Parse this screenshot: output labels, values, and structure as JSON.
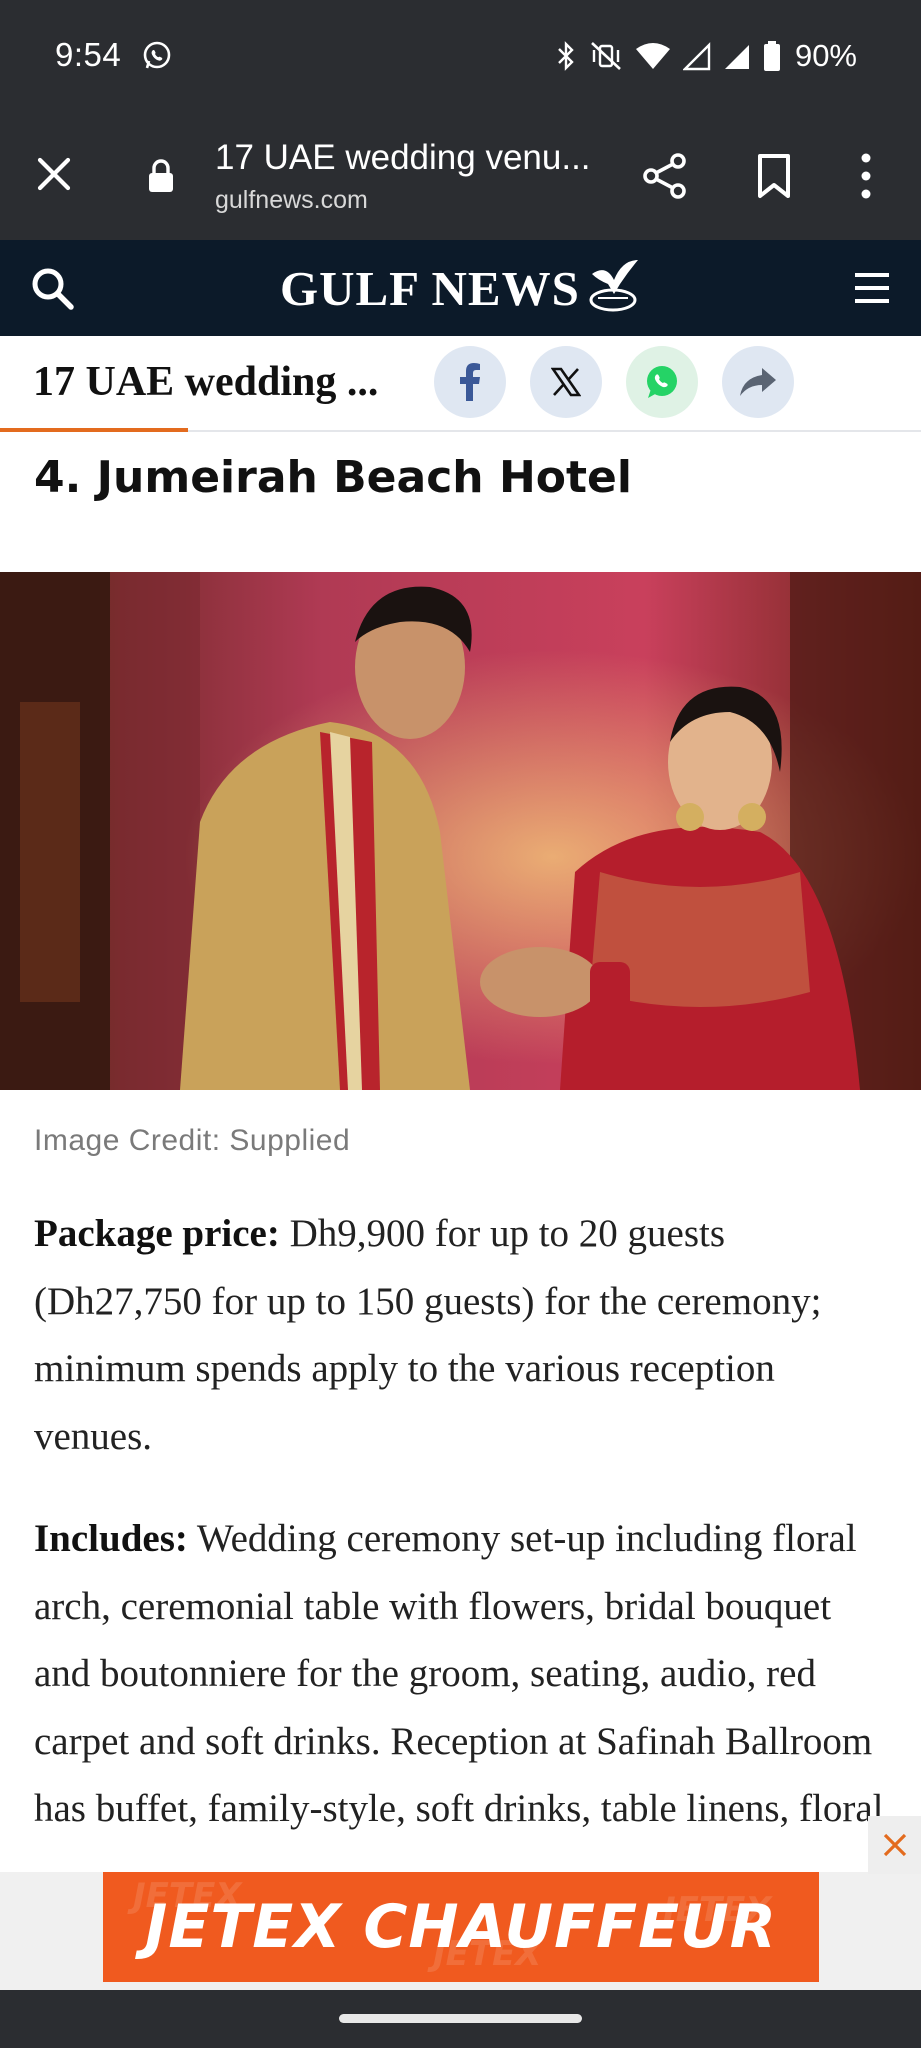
{
  "status_bar": {
    "time": "9:54",
    "battery": "90%"
  },
  "browser": {
    "page_title": "17 UAE wedding venu...",
    "url": "gulfnews.com"
  },
  "site": {
    "logo": "GULF NEWS"
  },
  "sticky_bar": {
    "title": "17 UAE wedding ..."
  },
  "article": {
    "heading": "4. Jumeirah Beach Hotel",
    "image_credit": "Image Credit: Supplied",
    "p1_label": "Package price:",
    "p1_text": " Dh9,900 for up to 20 guests (Dh27,750 for up to 150 guests) for the ceremony; minimum spends apply to the various reception venues.",
    "p2_label": "Includes:",
    "p2_text": " Wedding ceremony set-up including floral arch, ceremonial table with flowers, bridal bouquet and boutonniere for the groom, seating, audio, red carpet and soft drinks. Reception at Safinah Ballroom has buffet, family-style, soft drinks, table linens, floral"
  },
  "ad": {
    "text": "JETEX CHAUFFEUR",
    "watermark": "JETEX"
  },
  "colors": {
    "header_bg": "#0c1a29",
    "chrome_bg": "#2b2d31",
    "progress": "#e36b1e",
    "ad_orange": "#f05a1f"
  }
}
